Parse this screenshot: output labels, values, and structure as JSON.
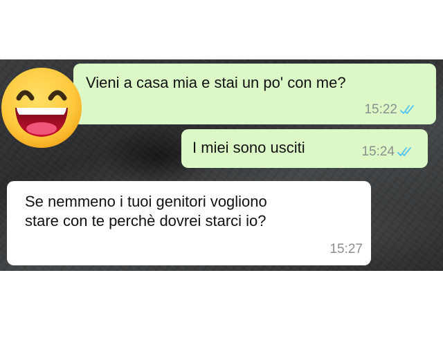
{
  "conversation": {
    "messages": [
      {
        "direction": "outgoing",
        "text": "Vieni a casa mia e stai un po' con me?",
        "time": "15:22",
        "status": "read"
      },
      {
        "direction": "outgoing",
        "text": "I miei sono usciti",
        "time": "15:24",
        "status": "read"
      },
      {
        "direction": "incoming",
        "lines": [
          "Se nemmeno i tuoi genitori vogliono",
          "stare con te perchè dovrei starci io?"
        ],
        "time": "15:27"
      }
    ]
  },
  "overlay": {
    "emoji": "grinning-face-with-big-eyes-icon"
  },
  "colors": {
    "outgoing_bubble": "#dcf8c6",
    "incoming_bubble": "#ffffff",
    "read_ticks": "#4fc3f7",
    "timestamp": "#8a8f8c",
    "emoji_face": "#ffc83d",
    "emoji_mouth": "#c8102e"
  }
}
